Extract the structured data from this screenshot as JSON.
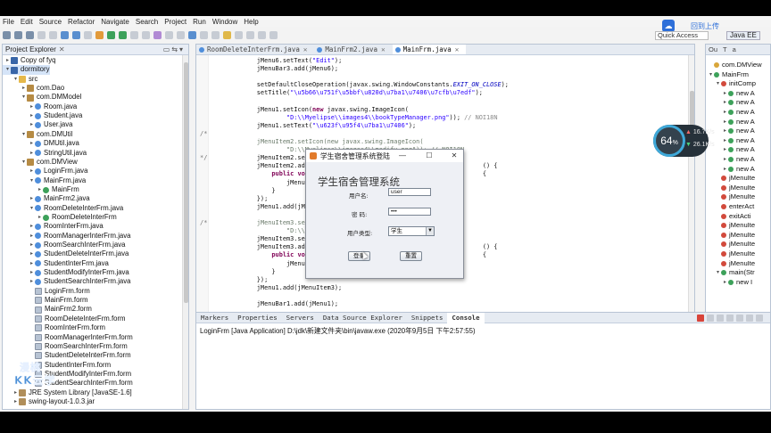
{
  "menu": [
    "File",
    "Edit",
    "Source",
    "Refactor",
    "Navigate",
    "Search",
    "Project",
    "Run",
    "Window",
    "Help"
  ],
  "cloud_upload": "回到上传",
  "quick_access": "Quick Access",
  "perspective": "Java EE",
  "explorer": {
    "title": "Project Explorer",
    "tree": [
      {
        "label": "Copy of fyq",
        "depth": 0,
        "arrow": "▸",
        "icon": "proj"
      },
      {
        "label": "dormitory",
        "depth": 0,
        "arrow": "▾",
        "icon": "proj",
        "selected": true
      },
      {
        "label": "src",
        "depth": 1,
        "arrow": "▾",
        "icon": "folder"
      },
      {
        "label": "com.Dao",
        "depth": 2,
        "arrow": "▸",
        "icon": "pkg"
      },
      {
        "label": "com.DMModel",
        "depth": 2,
        "arrow": "▾",
        "icon": "pkg"
      },
      {
        "label": "Room.java",
        "depth": 3,
        "arrow": "▸",
        "icon": "java"
      },
      {
        "label": "Student.java",
        "depth": 3,
        "arrow": "▸",
        "icon": "java"
      },
      {
        "label": "User.java",
        "depth": 3,
        "arrow": "▸",
        "icon": "java"
      },
      {
        "label": "com.DMUtil",
        "depth": 2,
        "arrow": "▾",
        "icon": "pkg"
      },
      {
        "label": "DMUtil.java",
        "depth": 3,
        "arrow": "▸",
        "icon": "java"
      },
      {
        "label": "StringUtil.java",
        "depth": 3,
        "arrow": "▸",
        "icon": "java"
      },
      {
        "label": "com.DMView",
        "depth": 2,
        "arrow": "▾",
        "icon": "pkg"
      },
      {
        "label": "LoginFrm.java",
        "depth": 3,
        "arrow": "▸",
        "icon": "java"
      },
      {
        "label": "MainFrm.java",
        "depth": 3,
        "arrow": "▾",
        "icon": "java"
      },
      {
        "label": "MainFrm",
        "depth": 4,
        "arrow": "▸",
        "icon": "cls"
      },
      {
        "label": "MainFrm2.java",
        "depth": 3,
        "arrow": "▸",
        "icon": "java"
      },
      {
        "label": "RoomDeleteInterFrm.java",
        "depth": 3,
        "arrow": "▾",
        "icon": "java"
      },
      {
        "label": "RoomDeleteInterFrm",
        "depth": 4,
        "arrow": "▸",
        "icon": "cls"
      },
      {
        "label": "RoomInterFrm.java",
        "depth": 3,
        "arrow": "▸",
        "icon": "java"
      },
      {
        "label": "RoomManagerInterFrm.java",
        "depth": 3,
        "arrow": "▸",
        "icon": "java"
      },
      {
        "label": "RoomSearchInterFrm.java",
        "depth": 3,
        "arrow": "▸",
        "icon": "java"
      },
      {
        "label": "StudentDeleteInterFrm.java",
        "depth": 3,
        "arrow": "▸",
        "icon": "java"
      },
      {
        "label": "StudentInterFrm.java",
        "depth": 3,
        "arrow": "▸",
        "icon": "java"
      },
      {
        "label": "StudentModifyInterFrm.java",
        "depth": 3,
        "arrow": "▸",
        "icon": "java"
      },
      {
        "label": "StudentSearchInterFrm.java",
        "depth": 3,
        "arrow": "▸",
        "icon": "java"
      },
      {
        "label": "LoginFrm.form",
        "depth": 3,
        "arrow": "",
        "icon": "form"
      },
      {
        "label": "MainFrm.form",
        "depth": 3,
        "arrow": "",
        "icon": "form"
      },
      {
        "label": "MainFrm2.form",
        "depth": 3,
        "arrow": "",
        "icon": "form"
      },
      {
        "label": "RoomDeleteInterFrm.form",
        "depth": 3,
        "arrow": "",
        "icon": "form"
      },
      {
        "label": "RoomInterFrm.form",
        "depth": 3,
        "arrow": "",
        "icon": "form"
      },
      {
        "label": "RoomManagerInterFrm.form",
        "depth": 3,
        "arrow": "",
        "icon": "form"
      },
      {
        "label": "RoomSearchInterFrm.form",
        "depth": 3,
        "arrow": "",
        "icon": "form"
      },
      {
        "label": "StudentDeleteInterFrm.form",
        "depth": 3,
        "arrow": "",
        "icon": "form"
      },
      {
        "label": "StudentInterFrm.form",
        "depth": 3,
        "arrow": "",
        "icon": "form"
      },
      {
        "label": "StudentModifyInterFrm.form",
        "depth": 3,
        "arrow": "",
        "icon": "form"
      },
      {
        "label": "StudentSearchInterFrm.form",
        "depth": 3,
        "arrow": "",
        "icon": "form"
      },
      {
        "label": "JRE System Library [JavaSE-1.6]",
        "depth": 1,
        "arrow": "▸",
        "icon": "jar"
      },
      {
        "label": "swing-layout-1.0.3.jar",
        "depth": 1,
        "arrow": "▸",
        "icon": "jar"
      }
    ]
  },
  "editor": {
    "tabs": [
      {
        "label": "RoomDeleteInterFrm.java",
        "active": false
      },
      {
        "label": "MainFrm2.java",
        "active": false
      },
      {
        "label": "MainFrm.java",
        "active": true
      }
    ],
    "lines": [
      {
        "fold": "",
        "html": "            jMenu6.setText(<span class='st'>\"Edit\"</span>);"
      },
      {
        "fold": "",
        "html": "            jMenuBar3.add(jMenu6);"
      },
      {
        "fold": "",
        "html": ""
      },
      {
        "fold": "",
        "html": "            setDefaultCloseOperation(javax.swing.WindowConstants.<span class='fd'>EXIT_ON_CLOSE</span>);"
      },
      {
        "fold": "",
        "html": "            setTitle(<span class='st'>\"\\u5b66\\u751f\\u5bbf\\u820d\\u7ba1\\u7406\\u7cfb\\u7edf\"</span>);"
      },
      {
        "fold": "",
        "html": ""
      },
      {
        "fold": "",
        "html": "            jMenu1.setIcon(<span class='kw'>new</span> javax.swing.ImageIcon("
      },
      {
        "fold": "",
        "html": "                    <span class='st'>\"D:\\\\Myelipse\\\\images4\\\\bookTypeManager.png\"</span>)); <span class='nl'>// NOI18N</span>"
      },
      {
        "fold": "",
        "html": "            jMenu1.setText(<span class='st'>\"\\u623f\\u95f4\\u7ba1\\u7406\"</span>);"
      },
      {
        "fold": "/*",
        "html": ""
      },
      {
        "fold": "",
        "html": "            <span class='cm'>jMenuItem2.setIcon(new javax.swing.ImageIcon(</span>"
      },
      {
        "fold": "",
        "html": "            <span class='cm'>        \"D:\\\\Myelipse\\\\images4\\\\modify.png\")); // NOI18N</span>"
      },
      {
        "fold": " */",
        "html": "            jMenuItem2.setText"
      },
      {
        "fold": "",
        "html": "            jMenuItem2.addActi                                           () {"
      },
      {
        "fold": "",
        "html": "                <span class='kw'>public</span> <span class='kw'>void</span> ac                                           {"
      },
      {
        "fold": "",
        "html": "                    jMenuItem2                                          "
      },
      {
        "fold": "",
        "html": "                }"
      },
      {
        "fold": "",
        "html": "            });"
      },
      {
        "fold": "",
        "html": "            jMenu1.add(jMenuIte"
      },
      {
        "fold": "",
        "html": ""
      },
      {
        "fold": "/*",
        "html": "            <span class='cm'>jMenuItem3.setIcon</span>"
      },
      {
        "fold": "",
        "html": "            <span class='cm'>        \"D:\\\\Myelip</span>"
      },
      {
        "fold": "",
        "html": "            jMenuItem3.setText"
      },
      {
        "fold": "",
        "html": "            jMenuItem3.addActi                                           () {"
      },
      {
        "fold": "",
        "html": "                <span class='kw'>public</span> <span class='kw'>void</span> ac                                           {"
      },
      {
        "fold": "",
        "html": "                    jMenuItem3                                          "
      },
      {
        "fold": "",
        "html": "                }"
      },
      {
        "fold": "",
        "html": "            });"
      },
      {
        "fold": "",
        "html": "            jMenu1.add(jMenuItem3);"
      },
      {
        "fold": "",
        "html": ""
      },
      {
        "fold": "",
        "html": "            jMenuBar1.add(jMenu1);"
      }
    ]
  },
  "outline": {
    "tabs": [
      "Ou",
      "T",
      "a"
    ],
    "rows": [
      {
        "label": "com.DMView",
        "depth": 0,
        "arrow": "",
        "dot": "y"
      },
      {
        "label": "MainFrm",
        "depth": 0,
        "arrow": "▾",
        "dot": "g"
      },
      {
        "label": "initComp",
        "depth": 1,
        "arrow": "▾",
        "dot": "r"
      },
      {
        "label": "new A",
        "depth": 2,
        "arrow": "▸",
        "dot": "g"
      },
      {
        "label": "new A",
        "depth": 2,
        "arrow": "▸",
        "dot": "g"
      },
      {
        "label": "new A",
        "depth": 2,
        "arrow": "▸",
        "dot": "g"
      },
      {
        "label": "new A",
        "depth": 2,
        "arrow": "▸",
        "dot": "g"
      },
      {
        "label": "new A",
        "depth": 2,
        "arrow": "▸",
        "dot": "g"
      },
      {
        "label": "new A",
        "depth": 2,
        "arrow": "▸",
        "dot": "g"
      },
      {
        "label": "new A",
        "depth": 2,
        "arrow": "▸",
        "dot": "g"
      },
      {
        "label": "new A",
        "depth": 2,
        "arrow": "▸",
        "dot": "g"
      },
      {
        "label": "new A",
        "depth": 2,
        "arrow": "▸",
        "dot": "g"
      },
      {
        "label": "jMenuIte",
        "depth": 1,
        "arrow": "",
        "dot": "r"
      },
      {
        "label": "jMenuIte",
        "depth": 1,
        "arrow": "",
        "dot": "r"
      },
      {
        "label": "jMenuIte",
        "depth": 1,
        "arrow": "",
        "dot": "r"
      },
      {
        "label": "enterAct",
        "depth": 1,
        "arrow": "",
        "dot": "r"
      },
      {
        "label": "exitActi",
        "depth": 1,
        "arrow": "",
        "dot": "r"
      },
      {
        "label": "jMenuIte",
        "depth": 1,
        "arrow": "",
        "dot": "r"
      },
      {
        "label": "jMenuIte",
        "depth": 1,
        "arrow": "",
        "dot": "r"
      },
      {
        "label": "jMenuIte",
        "depth": 1,
        "arrow": "",
        "dot": "r"
      },
      {
        "label": "jMenuIte",
        "depth": 1,
        "arrow": "",
        "dot": "r"
      },
      {
        "label": "jMenuIte",
        "depth": 1,
        "arrow": "",
        "dot": "r"
      },
      {
        "label": "main(Str",
        "depth": 1,
        "arrow": "▾",
        "dot": "g"
      },
      {
        "label": "new I",
        "depth": 2,
        "arrow": "▸",
        "dot": "g"
      }
    ]
  },
  "console": {
    "tabs": [
      "Markers",
      "Properties",
      "Servers",
      "Data Source Explorer",
      "Snippets",
      "Console"
    ],
    "active_tab": "Console",
    "line": "LoginFrm [Java Application] D:\\jdk\\新建文件夹\\bin\\javaw.exe (2020年9月5日 下午2:57:55)"
  },
  "gauge": {
    "percent": "64",
    "percent_sign": "%",
    "up": "16.7",
    "up_unit": "K/s",
    "down": "26.1",
    "down_unit": "K/s"
  },
  "dialog": {
    "title": "学生宿舍管理系统登陆",
    "heading": "学生宿舍管理系统",
    "username_label": "用户名:",
    "username_value": "user",
    "password_label": "密  码:",
    "password_value": "•••",
    "usertype_label": "用户类型:",
    "usertype_value": "学生",
    "login_button": "登录",
    "reset_button": "重置"
  },
  "watermark": {
    "line1": "漫桃",
    "line2": "KK云学"
  }
}
